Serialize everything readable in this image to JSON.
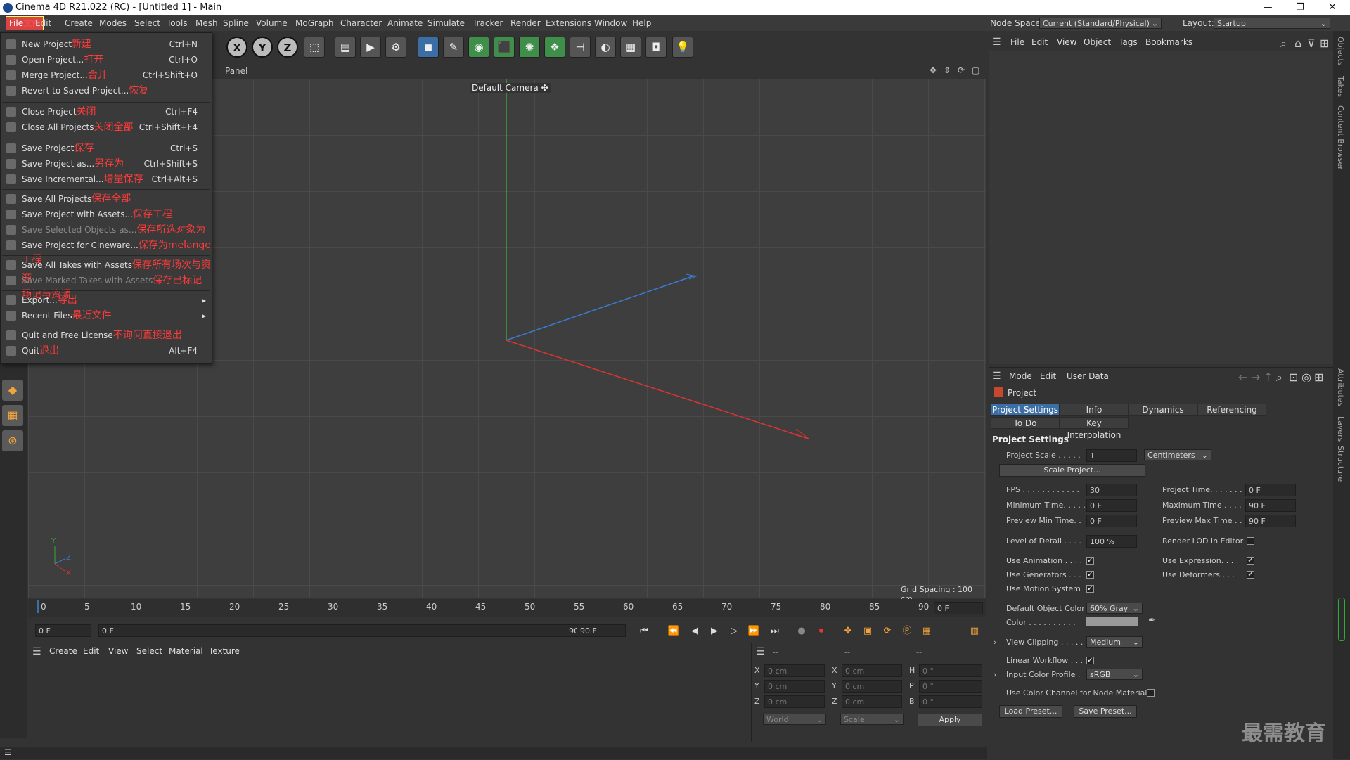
{
  "window": {
    "title": "Cinema 4D R21.022 (RC) - [Untitled 1] - Main",
    "controls": [
      "—",
      "❐",
      "✕"
    ]
  },
  "menubar": {
    "file": "File",
    "file_zh": "文件",
    "items": [
      "Edit",
      "Create",
      "Modes",
      "Select",
      "Tools",
      "Mesh",
      "Spline",
      "Volume",
      "MoGraph",
      "Character",
      "Animate",
      "Simulate",
      "Tracker",
      "Render",
      "Extensions",
      "Window",
      "Help"
    ],
    "node_space_label": "Node Space:",
    "node_space_value": "Current (Standard/Physical)",
    "layout_label": "Layout:",
    "layout_value": "Startup"
  },
  "file_menu": [
    {
      "label": "New Project",
      "zh": "新建",
      "shortcut": "Ctrl+N",
      "disabled": false
    },
    {
      "label": "Open Project...",
      "zh": "打开",
      "shortcut": "Ctrl+O",
      "disabled": false
    },
    {
      "label": "Merge Project...",
      "zh": "合并",
      "shortcut": "Ctrl+Shift+O",
      "disabled": false
    },
    {
      "label": "Revert to Saved Project...",
      "zh": "恢复",
      "shortcut": "",
      "disabled": false
    },
    {
      "label": "Close Project",
      "zh": "关闭",
      "shortcut": "Ctrl+F4",
      "disabled": false
    },
    {
      "label": "Close All Projects",
      "zh": "关闭全部",
      "shortcut": "Ctrl+Shift+F4",
      "disabled": false
    },
    {
      "label": "Save Project",
      "zh": "保存",
      "shortcut": "Ctrl+S",
      "disabled": false
    },
    {
      "label": "Save Project as...",
      "zh": "另存为",
      "shortcut": "Ctrl+Shift+S",
      "disabled": false
    },
    {
      "label": "Save Incremental...",
      "zh": "增量保存",
      "shortcut": "Ctrl+Alt+S",
      "disabled": false
    },
    {
      "label": "Save All Projects",
      "zh": "保存全部",
      "shortcut": "",
      "disabled": false
    },
    {
      "label": "Save Project with Assets...",
      "zh": "保存工程",
      "shortcut": "",
      "disabled": false
    },
    {
      "label": "Save Selected Objects as...",
      "zh": "保存所选对象为",
      "shortcut": "",
      "disabled": true
    },
    {
      "label": "Save Project for Cineware...",
      "zh": "保存为melange工程",
      "shortcut": "",
      "disabled": false
    },
    {
      "label": "Save All Takes with Assets",
      "zh": "保存所有场次与资源",
      "shortcut": "",
      "disabled": false
    },
    {
      "label": "Save Marked Takes with Assets",
      "zh": "保存已标记场记与资源",
      "shortcut": "",
      "disabled": true
    },
    {
      "label": "Export...",
      "zh": "导出",
      "shortcut": "",
      "disabled": false,
      "submenu": true
    },
    {
      "label": "Recent Files",
      "zh": "最近文件",
      "shortcut": "",
      "disabled": false,
      "submenu": true
    },
    {
      "label": "Quit and Free License",
      "zh": "不询问直接退出",
      "shortcut": "",
      "disabled": false
    },
    {
      "label": "Quit",
      "zh": "退出",
      "shortcut": "Alt+F4",
      "disabled": false
    }
  ],
  "viewport": {
    "panel_menu": "Panel",
    "camera": "Default Camera",
    "grid_spacing": "Grid Spacing : 100 cm",
    "axis_y": "Y",
    "axis_z": "Z",
    "axis_x": "X"
  },
  "timeline": {
    "ticks": [
      "0",
      "5",
      "10",
      "15",
      "20",
      "25",
      "30",
      "35",
      "40",
      "45",
      "50",
      "55",
      "60",
      "65",
      "70",
      "75",
      "80",
      "85",
      "90"
    ],
    "current_frame": "0 F",
    "start": "0 F",
    "range_start": "0 F",
    "range_end": "90 F",
    "end": "90 F"
  },
  "material_manager": {
    "menus": [
      "Create",
      "Edit",
      "View",
      "Select",
      "Material",
      "Texture"
    ]
  },
  "coordinates": {
    "header": [
      "--",
      "--",
      "--"
    ],
    "rows": [
      {
        "a": "X",
        "av": "0 cm",
        "b": "X",
        "bv": "0 cm",
        "c": "H",
        "cv": "0 °"
      },
      {
        "a": "Y",
        "av": "0 cm",
        "b": "Y",
        "bv": "0 cm",
        "c": "P",
        "cv": "0 °"
      },
      {
        "a": "Z",
        "av": "0 cm",
        "b": "Z",
        "bv": "0 cm",
        "c": "B",
        "cv": "0 °"
      }
    ],
    "mode": "World",
    "scale": "Scale",
    "apply": "Apply"
  },
  "object_manager": {
    "menus": [
      "File",
      "Edit",
      "View",
      "Object",
      "Tags",
      "Bookmarks"
    ]
  },
  "attributes": {
    "menus": [
      "Mode",
      "Edit",
      "User Data"
    ],
    "object": "Project",
    "tabs": [
      "Project Settings",
      "Info",
      "Dynamics",
      "Referencing"
    ],
    "tabs2": [
      "To Do",
      "Key Interpolation"
    ],
    "section": "Project Settings",
    "project_scale_label": "Project Scale . . . . .",
    "project_scale_value": "1",
    "project_scale_unit": "Centimeters",
    "scale_button": "Scale Project...",
    "fps_label": "FPS . . . . . . . . . . . .",
    "fps": "30",
    "project_time_label": "Project Time. . . . . . .",
    "project_time": "0 F",
    "min_time_label": "Minimum Time. . . . .",
    "min_time": "0 F",
    "max_time_label": "Maximum Time . . . .",
    "max_time": "90 F",
    "prev_min_label": "Preview Min Time. .",
    "prev_min": "0 F",
    "prev_max_label": "Preview Max Time . .",
    "prev_max": "90 F",
    "lod_label": "Level of Detail . . . .",
    "lod": "100 %",
    "render_lod": "Render LOD in Editor",
    "use_animation": "Use Animation . . . .",
    "use_expression": "Use Expression. . . .",
    "use_generators": "Use Generators . . .",
    "use_deformers": "Use Deformers . . .",
    "use_motion": "Use Motion System",
    "default_color_label": "Default Object Color",
    "default_color": "60% Gray",
    "color_label": "Color . . . . . . . . . .",
    "view_clipping_label": "View Clipping . . . . .",
    "view_clipping": "Medium",
    "linear_workflow": "Linear Workflow . . .",
    "input_profile_label": "Input Color Profile .",
    "input_profile": "sRGB",
    "use_color_channel": "Use Color Channel for Node Material",
    "load_preset": "Load Preset...",
    "save_preset": "Save Preset..."
  },
  "side_tabs": [
    "Objects",
    "Takes",
    "Content Browser",
    "Attributes",
    "Layers",
    "Structure"
  ],
  "watermark": "最需教育",
  "colors": {
    "accent": "#3b6ea5",
    "menu_highlight": "#d94545",
    "annotation": "#ff3b3b"
  }
}
